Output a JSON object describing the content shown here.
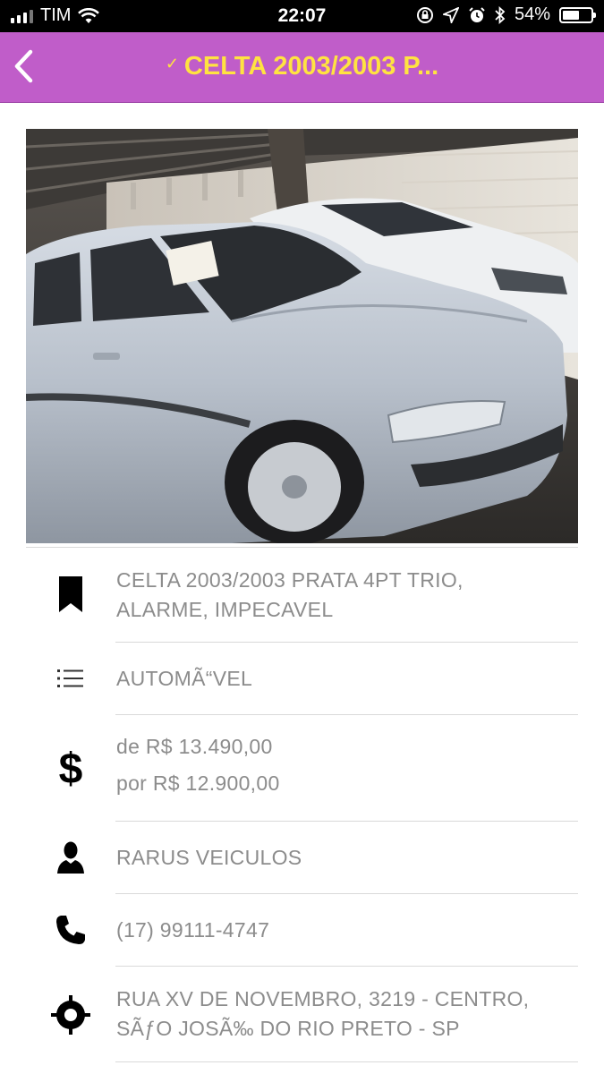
{
  "status_bar": {
    "carrier": "TIM",
    "time": "22:07",
    "battery": "54%",
    "battery_level": 0.54
  },
  "navbar": {
    "title_check": "✓",
    "title": "CELTA 2003/2003 P..."
  },
  "listing": {
    "description": "CELTA 2003/2003 PRATA 4PT TRIO, ALARME, IMPECAVEL",
    "transmission": "AUTOMÃ“VEL",
    "price_from": "de R$ 13.490,00",
    "price_to": "por R$ 12.900,00",
    "seller": "RARUS VEICULOS",
    "phone": "(17) 99111-4747",
    "address": "RUA XV DE NOVEMBRO, 3219 - CENTRO, SÃƒO JOSÃ‰ DO RIO PRETO - SP"
  },
  "icons": {
    "description": "bookmark-icon",
    "transmission": "list-icon",
    "price": "dollar-icon",
    "seller": "person-icon",
    "phone": "phone-icon",
    "address": "location-target-icon"
  },
  "colors": {
    "navbar_bg": "#c05dc9",
    "title_color": "#ffe341",
    "price_old": "#e21b1b",
    "price_new": "#1f8f1f"
  }
}
